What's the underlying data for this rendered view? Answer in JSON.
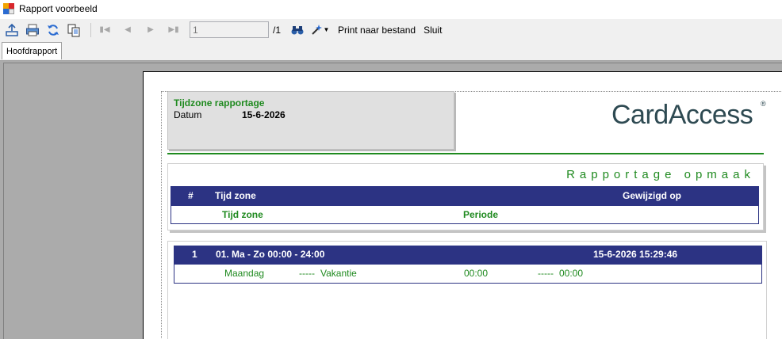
{
  "window": {
    "title": "Rapport voorbeeld"
  },
  "toolbar": {
    "page_value": "1",
    "page_total": "/1",
    "print_to_file_label": "Print naar bestand",
    "close_label": "Sluit"
  },
  "tabs": [
    {
      "label": "Hoofdrapport"
    }
  ],
  "report": {
    "title": "Tijdzone rapportage",
    "date_label": "Datum",
    "date_value": "15-6-2026",
    "logo_text": "CardAccess",
    "layout_title": "Rapportage opmaak",
    "layout_header": {
      "col_num": "#",
      "col_zone": "Tijd zone",
      "col_modified": "Gewijzigd op"
    },
    "layout_sub": {
      "col_zone": "Tijd zone",
      "col_period": "Periode"
    },
    "rows": [
      {
        "num": "1",
        "zone": "01. Ma - Zo 00:00 - 24:00",
        "modified": "15-6-2026 15:29:46",
        "detail": {
          "day": "Maandag",
          "dash1": "-----",
          "holiday": "Vakantie",
          "start": "00:00",
          "dash2": "-----",
          "end": "00:00"
        }
      }
    ]
  }
}
